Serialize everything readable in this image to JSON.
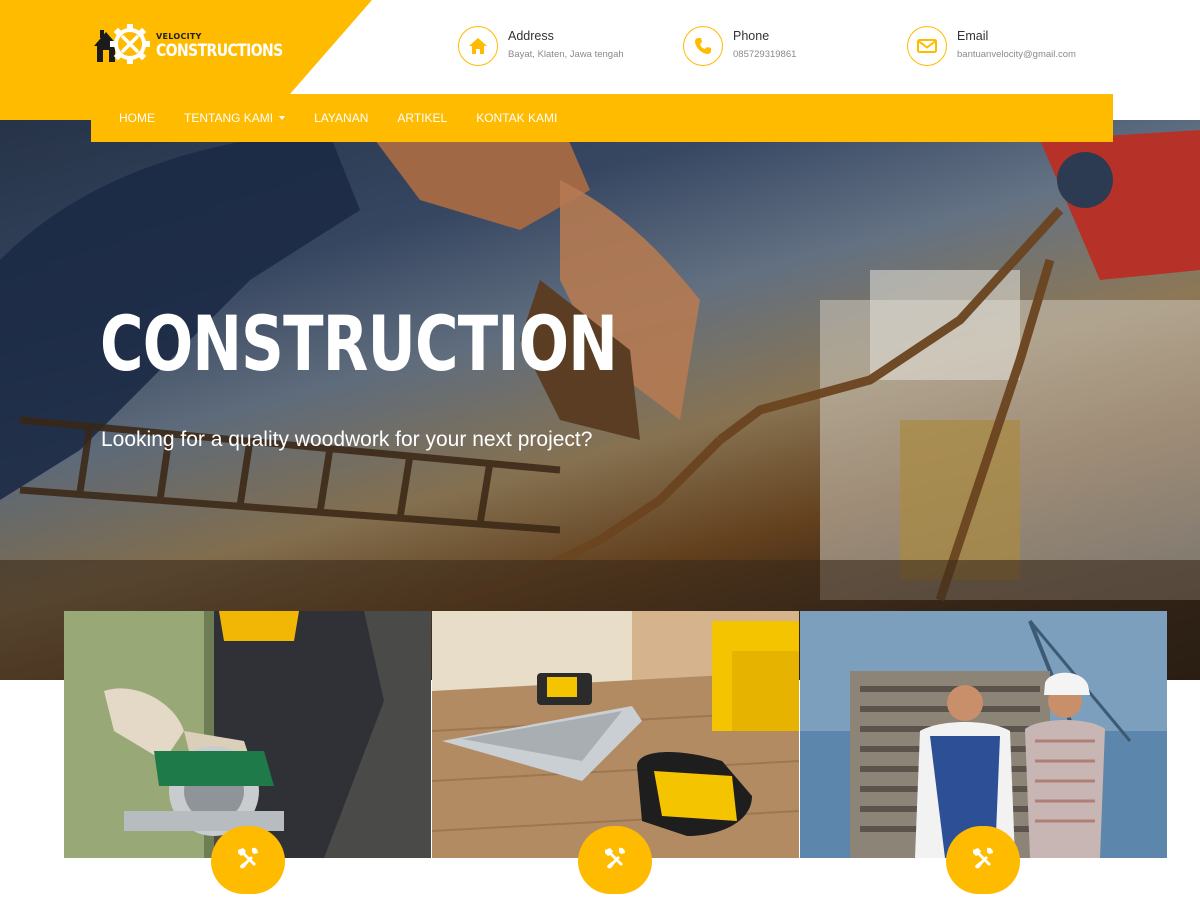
{
  "brand": {
    "small": "VELOCITY",
    "big": "CONSTRUCTIONS",
    "accent": "#ffbb00"
  },
  "contacts": [
    {
      "icon": "home-icon",
      "label": "Address",
      "value": "Bayat, Klaten, Jawa tengah"
    },
    {
      "icon": "phone-icon",
      "label": "Phone",
      "value": "085729319861"
    },
    {
      "icon": "envelope-icon",
      "label": "Email",
      "value": "bantuanvelocity@gmail.com"
    }
  ],
  "nav": {
    "items": [
      {
        "label": "HOME",
        "has_dropdown": false
      },
      {
        "label": "TENTANG KAMI",
        "has_dropdown": true
      },
      {
        "label": "LAYANAN",
        "has_dropdown": false
      },
      {
        "label": "ARTIKEL",
        "has_dropdown": false
      },
      {
        "label": "KONTAK KAMI",
        "has_dropdown": false
      }
    ]
  },
  "hero": {
    "title": "CONSTRUCTION",
    "subtitle": "Looking for a quality woodwork for your next project?"
  },
  "cards": [
    {
      "image": "worker-circular-saw",
      "icon": "tools-icon"
    },
    {
      "image": "tape-measure-lumber",
      "icon": "tools-icon"
    },
    {
      "image": "engineers-building-site",
      "icon": "tools-icon"
    }
  ]
}
